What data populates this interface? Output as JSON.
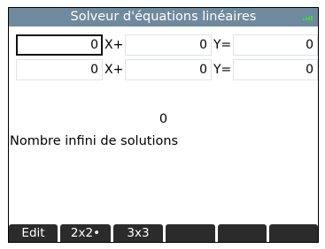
{
  "app": {
    "title": "Solveur d'équations linéaires"
  },
  "equations": [
    {
      "a": "0",
      "op1": "X+",
      "b": "0",
      "op2": "Y=",
      "c": "0"
    },
    {
      "a": "0",
      "op1": "X+",
      "b": "0",
      "op2": "Y=",
      "c": "0"
    }
  ],
  "result": {
    "value": "0",
    "message": "Nombre infini de solutions"
  },
  "softkeys": [
    "Edit",
    "2x2•",
    "3x3",
    "",
    "",
    ""
  ],
  "colors": {
    "titlebar": "#6f8a9e",
    "softkey": "#2b2b2b",
    "battery": "#3ddc3d"
  }
}
